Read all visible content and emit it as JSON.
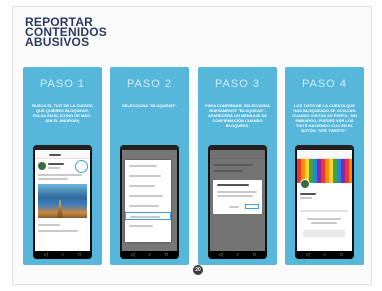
{
  "title": "REPORTAR\nCONTENIDOS\nABUSIVOS",
  "page_number": "20",
  "colors": {
    "panel": "#56b7da",
    "title": "#2b3a63",
    "highlight": "#3aa0e0"
  },
  "steps": [
    {
      "label": "PASO 1",
      "text": "BUSCA EL TUIT DE LA CUENTA QUE QUIERES BLOQUEAR. PULSA EN EL ÍCONO DE MÁS · (EN EL ANDROID)"
    },
    {
      "label": "PASO 2",
      "text": "SELECCIONA \"BLOQUEAR\"."
    },
    {
      "label": "PASO 3",
      "text": "PARA CONFIRMAR, SELECCIONA NUEVAMENTE \"BLOQUEAR\". APARECERÁ UN MENSAJE DE CONFIRMACIÓN CUANDO BLOQUEES."
    },
    {
      "label": "PASO 4",
      "text": "LOS TUITS DE LA CUENTA QUE HAS BLOQUEADO SE OCULTAN CUANDO VISITAS SU PERFIL. SIN EMBARGO, PUEDES VER LOS TUITS HACIENDO CLIC EN EL BOTÓN \"VER TWEETS\"."
    }
  ],
  "icons": [
    "back-icon",
    "home-icon",
    "recents-icon",
    "more-options-icon"
  ]
}
